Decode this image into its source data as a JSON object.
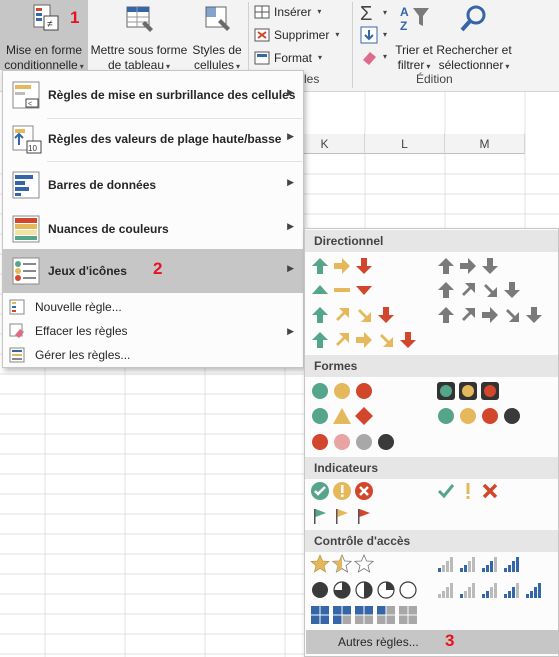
{
  "ribbon": {
    "cond_format": {
      "line1": "Mise en forme",
      "line2": "conditionnelle",
      "marker": "1"
    },
    "format_table": {
      "line1": "Mettre sous forme",
      "line2": "de tableau"
    },
    "cell_styles": {
      "line1": "Styles de",
      "line2": "cellules"
    },
    "cells_group": {
      "insert": "Insérer",
      "delete": "Supprimer",
      "format": "Format",
      "label_fragment": "les"
    },
    "edit_group": {
      "sort_filter": {
        "line1": "Trier et",
        "line2": "filtrer"
      },
      "find_select": {
        "line1": "Rechercher et",
        "line2": "sélectionner"
      },
      "label": "Édition"
    }
  },
  "sheet": {
    "columns": [
      "K",
      "L",
      "M"
    ]
  },
  "menu": {
    "items": [
      {
        "label": "Règles de mise en surbrillance des cellules",
        "icon": "highlight-rules-icon"
      },
      {
        "label": "Règles des valeurs de plage haute/basse",
        "icon": "top-bottom-rules-icon",
        "icon_text": "10"
      },
      {
        "label": "Barres de données",
        "icon": "data-bars-icon"
      },
      {
        "label": "Nuances de couleurs",
        "icon": "color-scales-icon"
      },
      {
        "label": "Jeux d'icônes",
        "icon": "icon-sets-icon",
        "marker": "2"
      }
    ],
    "small_items": [
      {
        "label": "Nouvelle règle..."
      },
      {
        "label": "Effacer les règles"
      },
      {
        "label": "Gérer les règles..."
      }
    ]
  },
  "panel": {
    "sections": {
      "directional": "Directionnel",
      "shapes": "Formes",
      "indicators": "Indicateurs",
      "ratings": "Contrôle d'accès"
    },
    "more_rules": "Autres règles...",
    "marker": "3"
  },
  "colors": {
    "green": "#55a58a",
    "yellow": "#e6b85c",
    "red": "#d2462c",
    "gray": "#7a7a7a",
    "blue": "#3566a8",
    "highlight": "#c6c6c6",
    "marker": "#e81123"
  }
}
